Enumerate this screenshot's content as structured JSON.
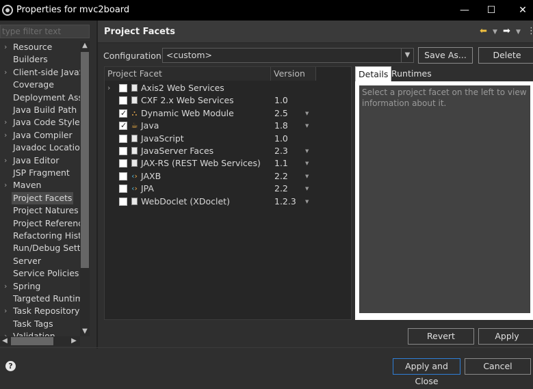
{
  "window": {
    "title": "Properties for mvc2board",
    "minimize": "—",
    "maximize": "☐",
    "close": "✕"
  },
  "filter": {
    "placeholder": "type filter text"
  },
  "tree": [
    {
      "label": "Resource",
      "expandable": true
    },
    {
      "label": "Builders",
      "expandable": false
    },
    {
      "label": "Client-side JavaSc",
      "expandable": true
    },
    {
      "label": "Coverage",
      "expandable": false
    },
    {
      "label": "Deployment Asse",
      "expandable": false
    },
    {
      "label": "Java Build Path",
      "expandable": false
    },
    {
      "label": "Java Code Style",
      "expandable": true
    },
    {
      "label": "Java Compiler",
      "expandable": true
    },
    {
      "label": "Javadoc Location",
      "expandable": false
    },
    {
      "label": "Java Editor",
      "expandable": true
    },
    {
      "label": "JSP Fragment",
      "expandable": false
    },
    {
      "label": "Maven",
      "expandable": true
    },
    {
      "label": "Project Facets",
      "expandable": false,
      "selected": true
    },
    {
      "label": "Project Natures",
      "expandable": false
    },
    {
      "label": "Project Reference",
      "expandable": false
    },
    {
      "label": "Refactoring Histor",
      "expandable": false
    },
    {
      "label": "Run/Debug Settin",
      "expandable": false
    },
    {
      "label": "Server",
      "expandable": false
    },
    {
      "label": "Service Policies",
      "expandable": false
    },
    {
      "label": "Spring",
      "expandable": true
    },
    {
      "label": "Targeted Runtime",
      "expandable": false
    },
    {
      "label": "Task Repository",
      "expandable": true
    },
    {
      "label": "Task Tags",
      "expandable": false
    },
    {
      "label": "Validation",
      "expandable": true
    }
  ],
  "page": {
    "title": "Project Facets",
    "config_label": "Configuration:",
    "config_value": "<custom>",
    "save_as": "Save As...",
    "delete": "Delete"
  },
  "facets": {
    "col_facet": "Project Facet",
    "col_version": "Version",
    "rows": [
      {
        "name": "Axis2 Web Services",
        "version": "",
        "checked": false,
        "expand": true,
        "icon": "doc-icon",
        "dropdown": false
      },
      {
        "name": "CXF 2.x Web Services",
        "version": "1.0",
        "checked": false,
        "expand": false,
        "icon": "doc-icon",
        "dropdown": false
      },
      {
        "name": "Dynamic Web Module",
        "version": "2.5",
        "checked": true,
        "expand": false,
        "icon": "web-module-icon",
        "dropdown": true
      },
      {
        "name": "Java",
        "version": "1.8",
        "checked": true,
        "expand": false,
        "icon": "java-icon",
        "dropdown": true
      },
      {
        "name": "JavaScript",
        "version": "1.0",
        "checked": false,
        "expand": false,
        "icon": "doc-icon",
        "dropdown": false
      },
      {
        "name": "JavaServer Faces",
        "version": "2.3",
        "checked": false,
        "expand": false,
        "icon": "doc-icon",
        "dropdown": true
      },
      {
        "name": "JAX-RS (REST Web Services)",
        "version": "1.1",
        "checked": false,
        "expand": false,
        "icon": "doc-icon",
        "dropdown": true
      },
      {
        "name": "JAXB",
        "version": "2.2",
        "checked": false,
        "expand": false,
        "icon": "jaxb-icon",
        "dropdown": true
      },
      {
        "name": "JPA",
        "version": "2.2",
        "checked": false,
        "expand": false,
        "icon": "jpa-icon",
        "dropdown": true
      },
      {
        "name": "WebDoclet (XDoclet)",
        "version": "1.2.3",
        "checked": false,
        "expand": false,
        "icon": "doc-icon",
        "dropdown": true
      }
    ]
  },
  "details": {
    "tab_details": "Details",
    "tab_runtimes": "Runtimes",
    "message": "Select a project facet on the left to view information about it."
  },
  "buttons": {
    "revert": "Revert",
    "apply": "Apply",
    "apply_close": "Apply and Close",
    "cancel": "Cancel"
  },
  "colors": {
    "accent": "#2f7fd8",
    "background": "#2f2f2f"
  }
}
